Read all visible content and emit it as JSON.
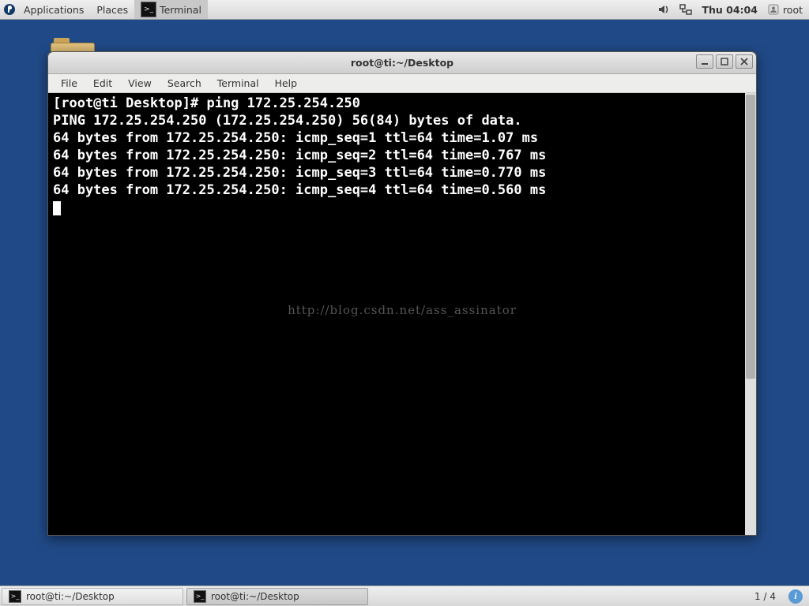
{
  "top_panel": {
    "applications": "Applications",
    "places": "Places",
    "task_terminal": "Terminal",
    "clock": "Thu 04:04",
    "user": "root"
  },
  "window": {
    "title": "root@ti:~/Desktop",
    "menu": {
      "file": "File",
      "edit": "Edit",
      "view": "View",
      "search": "Search",
      "terminal": "Terminal",
      "help": "Help"
    },
    "terminal": {
      "prompt": "[root@ti Desktop]# ",
      "command": "ping 172.25.254.250",
      "header": "PING 172.25.254.250 (172.25.254.250) 56(84) bytes of data.",
      "lines": [
        "64 bytes from 172.25.254.250: icmp_seq=1 ttl=64 time=1.07 ms",
        "64 bytes from 172.25.254.250: icmp_seq=2 ttl=64 time=0.767 ms",
        "64 bytes from 172.25.254.250: icmp_seq=3 ttl=64 time=0.770 ms",
        "64 bytes from 172.25.254.250: icmp_seq=4 ttl=64 time=0.560 ms"
      ]
    },
    "watermark": "http://blog.csdn.net/ass_assinator"
  },
  "bottom_panel": {
    "task1": "root@ti:~/Desktop",
    "task2": "root@ti:~/Desktop",
    "workspace": "1 / 4"
  }
}
